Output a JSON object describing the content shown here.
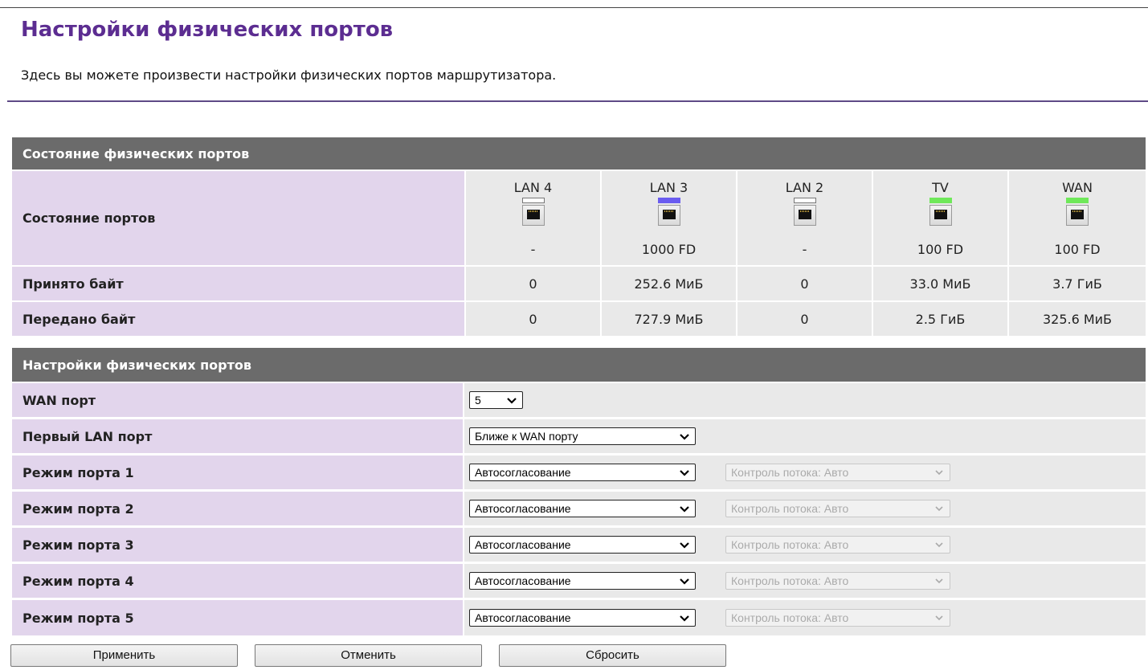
{
  "page": {
    "title": "Настройки физических портов",
    "description": "Здесь вы можете произвести настройки физических портов маршрутизатора."
  },
  "status": {
    "section_title": "Состояние физических портов",
    "ports_label": "Состояние портов",
    "received_label": "Принято байт",
    "sent_label": "Передано байт",
    "ports": [
      {
        "name": "LAN 4",
        "led_color": "#ffffff",
        "icon": "ethernet-port-icon",
        "speed": "-",
        "received": "0",
        "sent": "0"
      },
      {
        "name": "LAN 3",
        "led_color": "#6a5cf0",
        "icon": "ethernet-port-icon",
        "speed": "1000 FD",
        "received": "252.6 МиБ",
        "sent": "727.9 МиБ"
      },
      {
        "name": "LAN 2",
        "led_color": "#ffffff",
        "icon": "ethernet-port-icon",
        "speed": "-",
        "received": "0",
        "sent": "0"
      },
      {
        "name": "TV",
        "led_color": "#6fe85a",
        "icon": "ethernet-port-icon",
        "speed": "100 FD",
        "received": "33.0 МиБ",
        "sent": "2.5 ГиБ"
      },
      {
        "name": "WAN",
        "led_color": "#6fe85a",
        "icon": "ethernet-port-icon",
        "speed": "100 FD",
        "received": "3.7 ГиБ",
        "sent": "325.6 МиБ"
      }
    ]
  },
  "settings": {
    "section_title": "Настройки физических портов",
    "wan_port": {
      "label": "WAN порт",
      "value": "5"
    },
    "first_lan_port": {
      "label": "Первый LAN порт",
      "value": "Ближе к WAN порту"
    },
    "port_modes": [
      {
        "label": "Режим порта 1",
        "mode": "Автосогласование",
        "flow_control": "Контроль потока: Авто"
      },
      {
        "label": "Режим порта 2",
        "mode": "Автосогласование",
        "flow_control": "Контроль потока: Авто"
      },
      {
        "label": "Режим порта 3",
        "mode": "Автосогласование",
        "flow_control": "Контроль потока: Авто"
      },
      {
        "label": "Режим порта 4",
        "mode": "Автосогласование",
        "flow_control": "Контроль потока: Авто"
      },
      {
        "label": "Режим порта 5",
        "mode": "Автосогласование",
        "flow_control": "Контроль потока: Авто"
      }
    ]
  },
  "buttons": {
    "apply": "Применить",
    "cancel": "Отменить",
    "reset": "Сбросить"
  },
  "colors": {
    "title": "#5c2d91",
    "section_header_bg": "#6b6b6b",
    "label_bg": "#e2d5ec",
    "value_bg": "#e9e9e9"
  }
}
